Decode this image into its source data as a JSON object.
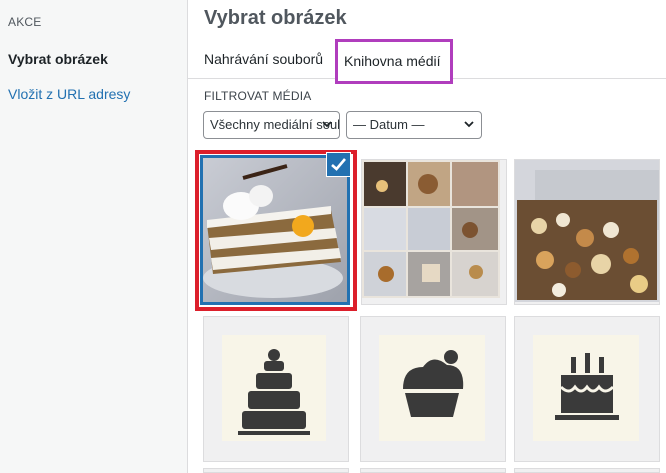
{
  "sidebar": {
    "section_title": "AKCE",
    "items": [
      {
        "label": "Vybrat obrázek"
      },
      {
        "label": "Vložit z URL adresy"
      }
    ]
  },
  "header": {
    "title": "Vybrat obrázek"
  },
  "tabs": [
    {
      "label": "Nahrávání souborů"
    },
    {
      "label": "Knihovna médií"
    }
  ],
  "filters": {
    "label": "FILTROVAT MÉDIA",
    "type_select": {
      "value": "Všechny mediální soubory"
    },
    "date_select": {
      "value": "— Datum —"
    }
  },
  "media": [
    {
      "icon": "carrot-cake-slice-photo",
      "selected": true
    },
    {
      "icon": "pastry-collage-photo",
      "selected": false
    },
    {
      "icon": "cookie-box-photo",
      "selected": false
    },
    {
      "icon": "layered-cake-icon",
      "selected": false
    },
    {
      "icon": "cupcake-icon",
      "selected": false
    },
    {
      "icon": "birthday-cake-icon",
      "selected": false
    }
  ],
  "colors": {
    "accent": "#2271b1",
    "highlight_red": "#dc1f2b",
    "highlight_purple": "#b03dbd"
  }
}
